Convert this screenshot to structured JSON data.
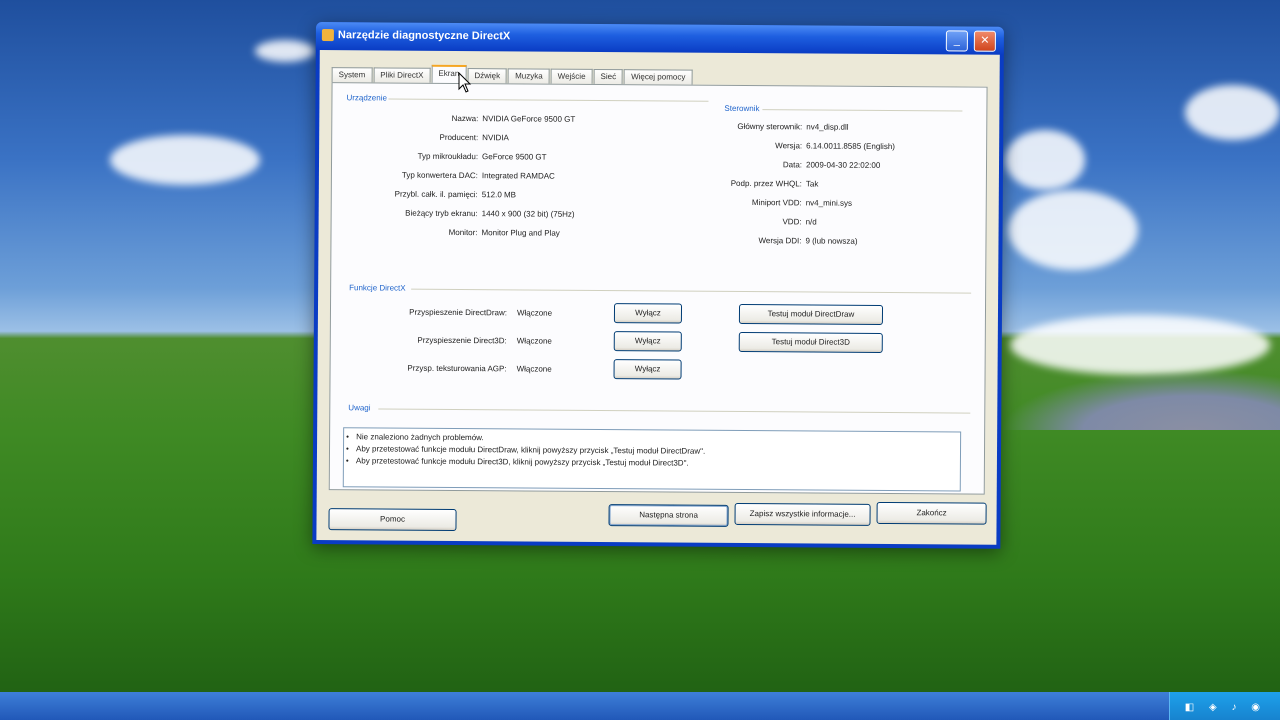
{
  "window": {
    "title": "Narzędzie diagnostyczne DirectX",
    "minimize_label": "_",
    "close_label": "✕"
  },
  "tabs": [
    {
      "label": "System",
      "active": false
    },
    {
      "label": "Pliki DirectX",
      "active": false
    },
    {
      "label": "Ekran",
      "active": true
    },
    {
      "label": "Dźwięk",
      "active": false
    },
    {
      "label": "Muzyka",
      "active": false
    },
    {
      "label": "Wejście",
      "active": false
    },
    {
      "label": "Sieć",
      "active": false
    },
    {
      "label": "Więcej pomocy",
      "active": false
    }
  ],
  "device": {
    "group_label": "Urządzenie",
    "rows": [
      {
        "label": "Nazwa:",
        "value": "NVIDIA GeForce 9500 GT"
      },
      {
        "label": "Producent:",
        "value": "NVIDIA"
      },
      {
        "label": "Typ mikroukładu:",
        "value": "GeForce 9500 GT"
      },
      {
        "label": "Typ konwertera DAC:",
        "value": "Integrated RAMDAC"
      },
      {
        "label": "Przybl. całk. il. pamięci:",
        "value": "512.0 MB"
      },
      {
        "label": "Bieżący tryb ekranu:",
        "value": "1440 x 900 (32 bit) (75Hz)"
      },
      {
        "label": "Monitor:",
        "value": "Monitor Plug and Play"
      }
    ]
  },
  "driver": {
    "group_label": "Sterownik",
    "rows": [
      {
        "label": "Główny sterownik:",
        "value": "nv4_disp.dll"
      },
      {
        "label": "Wersja:",
        "value": "6.14.0011.8585 (English)"
      },
      {
        "label": "Data:",
        "value": "2009-04-30 22:02:00"
      },
      {
        "label": "Podp. przez WHQL:",
        "value": "Tak"
      },
      {
        "label": "Miniport VDD:",
        "value": "nv4_mini.sys"
      },
      {
        "label": "VDD:",
        "value": "n/d"
      },
      {
        "label": "Wersja DDI:",
        "value": "9 (lub nowsza)"
      }
    ]
  },
  "directx_features": {
    "group_label": "Funkcje DirectX",
    "rows": [
      {
        "label": "Przyspieszenie DirectDraw:",
        "value": "Włączone",
        "button": "Wyłącz"
      },
      {
        "label": "Przyspieszenie Direct3D:",
        "value": "Włączone",
        "button": "Wyłącz"
      },
      {
        "label": "Przysp. teksturowania AGP:",
        "value": "Włączone",
        "button": "Wyłącz"
      }
    ],
    "test_directdraw": "Testuj moduł DirectDraw",
    "test_direct3d": "Testuj moduł Direct3D"
  },
  "notes": {
    "group_label": "Uwagi",
    "items": [
      "Nie znaleziono żadnych problemów.",
      "Aby przetestować funkcje modułu DirectDraw, kliknij powyższy przycisk „Testuj moduł DirectDraw\".",
      "Aby przetestować funkcje modułu Direct3D, kliknij powyższy przycisk „Testuj moduł Direct3D\"."
    ]
  },
  "footer": {
    "help": "Pomoc",
    "next_page": "Następna strona",
    "save_all": "Zapisz wszystkie informacje...",
    "exit": "Zakończ"
  },
  "colors": {
    "titlebar": "#0a3cc4",
    "dialog_bg": "#ece9d8",
    "group_label": "#2266cc",
    "active_tab_accent": "#f5a623"
  }
}
